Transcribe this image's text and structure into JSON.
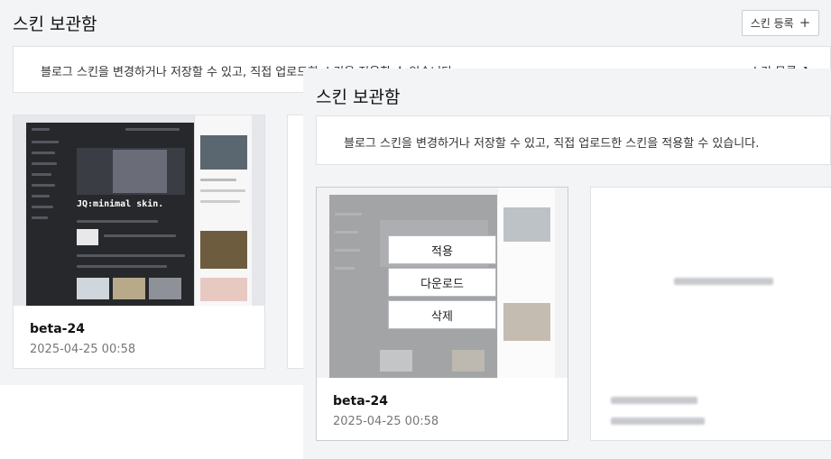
{
  "back": {
    "title": "스킨 보관함",
    "register_label": "스킨 등록",
    "register_icon": "plus-icon",
    "banner_text": "블로그 스킨을 변경하거나 저장할 수 있고, 직접 업로드한 스킨을 적용할 수 있습니다",
    "list_link": "스킨 목록",
    "card": {
      "name": "beta-24",
      "date": "2025-04-25 00:58",
      "hero_text": "JQ:minimal skin."
    }
  },
  "front": {
    "title": "스킨 보관함",
    "banner_text": "블로그 스킨을 변경하거나 저장할 수 있고, 직접 업로드한 스킨을 적용할 수 있습니다.",
    "card": {
      "name": "beta-24",
      "date": "2025-04-25 00:58",
      "actions": [
        "적용",
        "다운로드",
        "삭제"
      ]
    }
  },
  "colors": {
    "page_bg": "#f3f4f6",
    "card_border": "#e0e2e6",
    "dark_thumb": "#26282c"
  }
}
